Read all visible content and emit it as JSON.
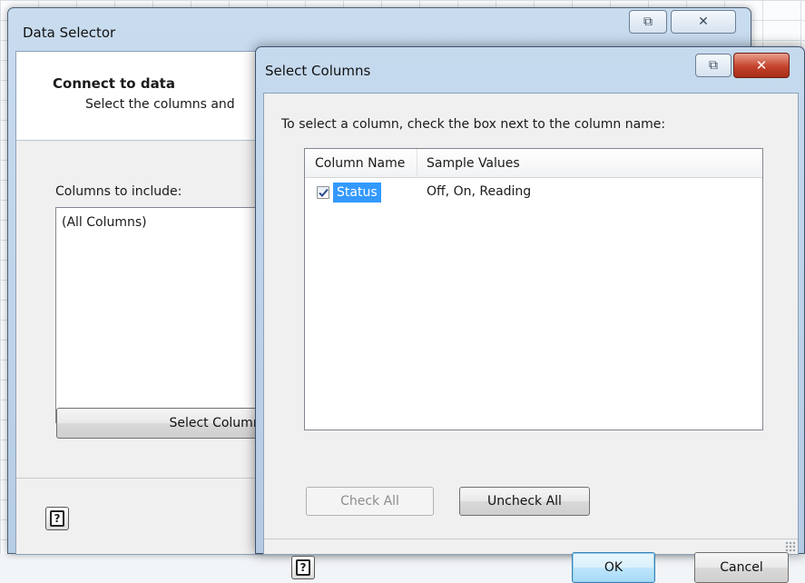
{
  "data_selector": {
    "title": "Data Selector",
    "header_title": "Connect to data",
    "header_subtitle": "Select the columns and",
    "columns_label": "Columns to include:",
    "columns_list": [
      "(All Columns)"
    ],
    "select_columns_button": "Select Columns"
  },
  "select_columns": {
    "title": "Select Columns",
    "instruction": "To select a column, check the box next to the column name:",
    "headers": [
      "Column Name",
      "Sample Values"
    ],
    "rows": [
      {
        "name": "Status",
        "sample": "Off, On, Reading",
        "checked": true,
        "selected": true
      }
    ],
    "check_all_button": "Check All",
    "uncheck_all_button": "Uncheck All",
    "ok_button": "OK",
    "cancel_button": "Cancel"
  },
  "icons": {
    "restore": "restore-icon",
    "close": "close-icon",
    "help": "help-icon",
    "check": "checkmark-icon"
  },
  "colors": {
    "selection": "#3399ff",
    "close_red": "#c4432c",
    "title_bar": "#c6daee"
  }
}
